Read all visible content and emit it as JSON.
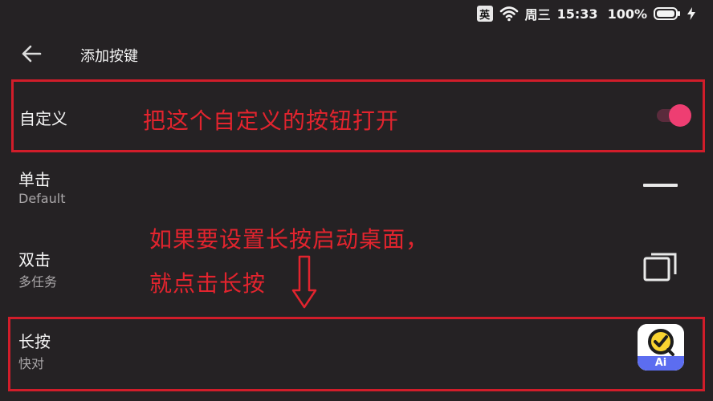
{
  "status_bar": {
    "ime": "英",
    "day": "周三",
    "time": "15:33",
    "battery": "100%"
  },
  "app_bar": {
    "title": "添加按键"
  },
  "rows": [
    {
      "title": "自定义",
      "subtitle": "",
      "toggle_on": true
    },
    {
      "title": "单击",
      "subtitle": "Default"
    },
    {
      "title": "双击",
      "subtitle": "多任务"
    },
    {
      "title": "长按",
      "subtitle": "快对"
    }
  ],
  "annotations": {
    "toggle_hint": "把这个自定义的按钮打开",
    "longpress_hint_line1": "如果要设置长按启动桌面，",
    "longpress_hint_line2": "就点击长按"
  },
  "icons": {
    "back": "arrow-left-icon",
    "wifi": "wifi-icon",
    "battery": "battery-icon",
    "charging": "bolt-icon",
    "single_tap": "dash-icon",
    "double_tap": "recent-apps-icon",
    "long_press": "app-icon-ai",
    "app_badge": "Ai"
  },
  "colors": {
    "background": "#252224",
    "annotation_red": "#e2242e",
    "toggle_accent": "#ee3e72"
  }
}
